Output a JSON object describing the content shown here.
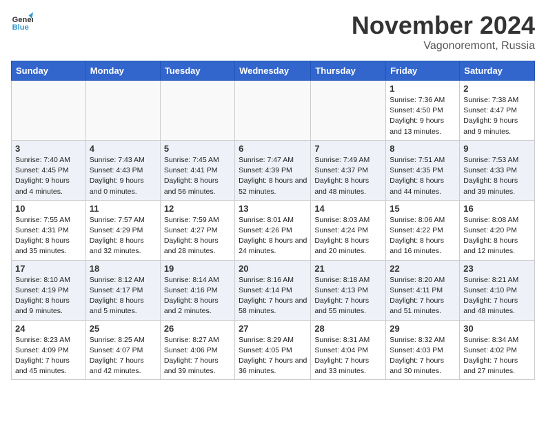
{
  "logo": {
    "line1": "General",
    "line2": "Blue"
  },
  "title": "November 2024",
  "location": "Vagonoremont, Russia",
  "weekdays": [
    "Sunday",
    "Monday",
    "Tuesday",
    "Wednesday",
    "Thursday",
    "Friday",
    "Saturday"
  ],
  "weeks": [
    [
      {
        "day": "",
        "info": ""
      },
      {
        "day": "",
        "info": ""
      },
      {
        "day": "",
        "info": ""
      },
      {
        "day": "",
        "info": ""
      },
      {
        "day": "",
        "info": ""
      },
      {
        "day": "1",
        "info": "Sunrise: 7:36 AM\nSunset: 4:50 PM\nDaylight: 9 hours and 13 minutes."
      },
      {
        "day": "2",
        "info": "Sunrise: 7:38 AM\nSunset: 4:47 PM\nDaylight: 9 hours and 9 minutes."
      }
    ],
    [
      {
        "day": "3",
        "info": "Sunrise: 7:40 AM\nSunset: 4:45 PM\nDaylight: 9 hours and 4 minutes."
      },
      {
        "day": "4",
        "info": "Sunrise: 7:43 AM\nSunset: 4:43 PM\nDaylight: 9 hours and 0 minutes."
      },
      {
        "day": "5",
        "info": "Sunrise: 7:45 AM\nSunset: 4:41 PM\nDaylight: 8 hours and 56 minutes."
      },
      {
        "day": "6",
        "info": "Sunrise: 7:47 AM\nSunset: 4:39 PM\nDaylight: 8 hours and 52 minutes."
      },
      {
        "day": "7",
        "info": "Sunrise: 7:49 AM\nSunset: 4:37 PM\nDaylight: 8 hours and 48 minutes."
      },
      {
        "day": "8",
        "info": "Sunrise: 7:51 AM\nSunset: 4:35 PM\nDaylight: 8 hours and 44 minutes."
      },
      {
        "day": "9",
        "info": "Sunrise: 7:53 AM\nSunset: 4:33 PM\nDaylight: 8 hours and 39 minutes."
      }
    ],
    [
      {
        "day": "10",
        "info": "Sunrise: 7:55 AM\nSunset: 4:31 PM\nDaylight: 8 hours and 35 minutes."
      },
      {
        "day": "11",
        "info": "Sunrise: 7:57 AM\nSunset: 4:29 PM\nDaylight: 8 hours and 32 minutes."
      },
      {
        "day": "12",
        "info": "Sunrise: 7:59 AM\nSunset: 4:27 PM\nDaylight: 8 hours and 28 minutes."
      },
      {
        "day": "13",
        "info": "Sunrise: 8:01 AM\nSunset: 4:26 PM\nDaylight: 8 hours and 24 minutes."
      },
      {
        "day": "14",
        "info": "Sunrise: 8:03 AM\nSunset: 4:24 PM\nDaylight: 8 hours and 20 minutes."
      },
      {
        "day": "15",
        "info": "Sunrise: 8:06 AM\nSunset: 4:22 PM\nDaylight: 8 hours and 16 minutes."
      },
      {
        "day": "16",
        "info": "Sunrise: 8:08 AM\nSunset: 4:20 PM\nDaylight: 8 hours and 12 minutes."
      }
    ],
    [
      {
        "day": "17",
        "info": "Sunrise: 8:10 AM\nSunset: 4:19 PM\nDaylight: 8 hours and 9 minutes."
      },
      {
        "day": "18",
        "info": "Sunrise: 8:12 AM\nSunset: 4:17 PM\nDaylight: 8 hours and 5 minutes."
      },
      {
        "day": "19",
        "info": "Sunrise: 8:14 AM\nSunset: 4:16 PM\nDaylight: 8 hours and 2 minutes."
      },
      {
        "day": "20",
        "info": "Sunrise: 8:16 AM\nSunset: 4:14 PM\nDaylight: 7 hours and 58 minutes."
      },
      {
        "day": "21",
        "info": "Sunrise: 8:18 AM\nSunset: 4:13 PM\nDaylight: 7 hours and 55 minutes."
      },
      {
        "day": "22",
        "info": "Sunrise: 8:20 AM\nSunset: 4:11 PM\nDaylight: 7 hours and 51 minutes."
      },
      {
        "day": "23",
        "info": "Sunrise: 8:21 AM\nSunset: 4:10 PM\nDaylight: 7 hours and 48 minutes."
      }
    ],
    [
      {
        "day": "24",
        "info": "Sunrise: 8:23 AM\nSunset: 4:09 PM\nDaylight: 7 hours and 45 minutes."
      },
      {
        "day": "25",
        "info": "Sunrise: 8:25 AM\nSunset: 4:07 PM\nDaylight: 7 hours and 42 minutes."
      },
      {
        "day": "26",
        "info": "Sunrise: 8:27 AM\nSunset: 4:06 PM\nDaylight: 7 hours and 39 minutes."
      },
      {
        "day": "27",
        "info": "Sunrise: 8:29 AM\nSunset: 4:05 PM\nDaylight: 7 hours and 36 minutes."
      },
      {
        "day": "28",
        "info": "Sunrise: 8:31 AM\nSunset: 4:04 PM\nDaylight: 7 hours and 33 minutes."
      },
      {
        "day": "29",
        "info": "Sunrise: 8:32 AM\nSunset: 4:03 PM\nDaylight: 7 hours and 30 minutes."
      },
      {
        "day": "30",
        "info": "Sunrise: 8:34 AM\nSunset: 4:02 PM\nDaylight: 7 hours and 27 minutes."
      }
    ]
  ]
}
